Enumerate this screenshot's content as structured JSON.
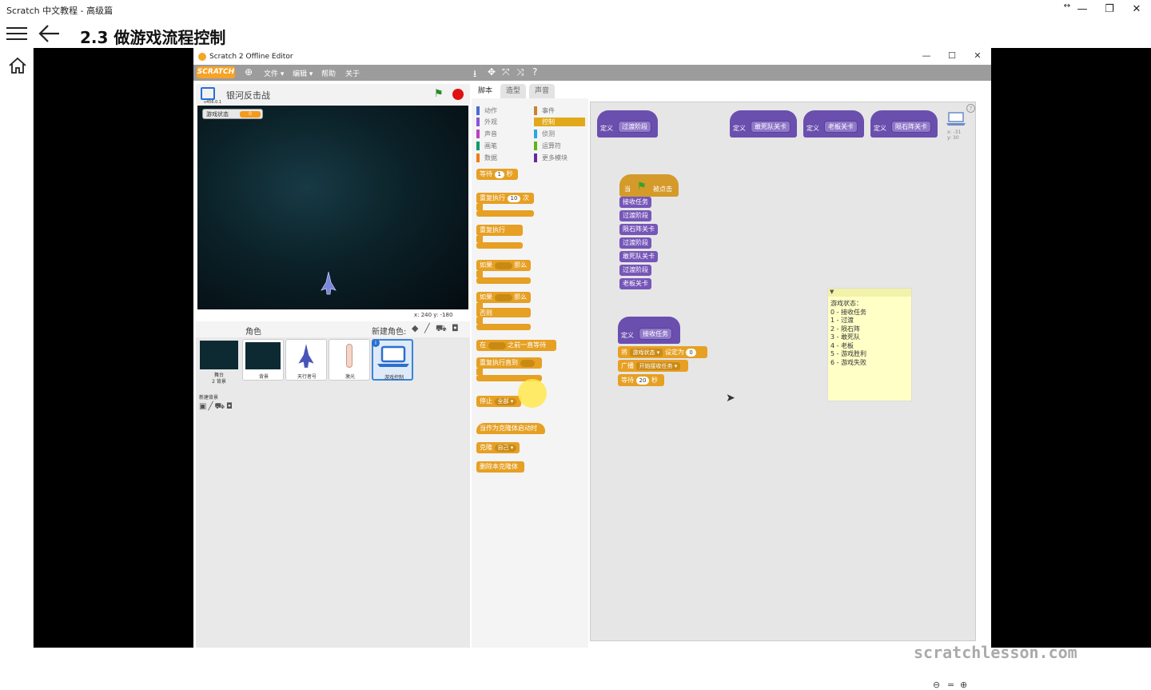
{
  "window": {
    "title": "Scratch 中文教程 - 高级篇",
    "resize_icon": "↔",
    "min": "—",
    "restore": "❐",
    "close": "✕"
  },
  "header": {
    "title": "2.3  做游戏流程控制"
  },
  "scratch": {
    "title": "Scratch 2 Offline Editor",
    "logo": "SCRATCH",
    "menu": [
      "文件 ▾",
      "编辑 ▾",
      "帮助",
      "关于"
    ],
    "tools": [
      "⭳",
      "✥",
      "⤧",
      "⤨",
      "?"
    ],
    "stage_title": "银河反击战",
    "version": "v456.0.1",
    "monitor": {
      "label": "游戏状态",
      "value": "0"
    },
    "coords": "x: 240   y: -180",
    "sprite_header": "角色",
    "new_sprite": "新建角色:",
    "stage_thumb": {
      "name": "舞台",
      "sub": "2 背景"
    },
    "new_backdrop": "新建背景",
    "sprites": [
      "背景",
      "天行者号",
      "激光",
      "游戏控制"
    ],
    "tabs": [
      "脚本",
      "造型",
      "声音"
    ],
    "categories_left": [
      "动作",
      "外观",
      "声音",
      "画笔",
      "数据"
    ],
    "categories_right": [
      "事件",
      "控制",
      "侦测",
      "运算符",
      "更多模块"
    ],
    "palette": {
      "wait": "等待",
      "wait_val": "1",
      "wait_unit": "秒",
      "repeat": "重复执行",
      "repeat_val": "10",
      "repeat_unit": "次",
      "forever": "重复执行",
      "if": "如果",
      "then": "那么",
      "if2": "如果",
      "then2": "那么",
      "else": "否则",
      "wait_until_pre": "在",
      "wait_until": "之前一直等待",
      "repeat_until": "重复执行直到",
      "stop": "停止",
      "stop_val": "全部 ▾",
      "clone_start": "当作为克隆体启动时",
      "clone": "克隆",
      "clone_val": "自己 ▾",
      "delete_clone": "删除本克隆体"
    },
    "defs": [
      {
        "k": "定义",
        "n": "过渡阶段"
      },
      {
        "k": "定义",
        "n": "敢死队关卡"
      },
      {
        "k": "定义",
        "n": "老板关卡"
      },
      {
        "k": "定义",
        "n": "陨石阵关卡"
      }
    ],
    "sprite_xy": "x: -31\ny: 30",
    "flag_script": {
      "hat_pre": "当",
      "hat_post": "被点击",
      "blocks": [
        "接收任务",
        "过渡阶段",
        "陨石阵关卡",
        "过渡阶段",
        "敢死队关卡",
        "过渡阶段",
        "老板关卡"
      ]
    },
    "recv_script": {
      "def": "定义",
      "name": "接收任务",
      "set": "将",
      "var": "游戏状态 ▾",
      "to": "设定为",
      "val": "0",
      "broadcast": "广播",
      "msg": "开始接收任务 ▾",
      "wait": "等待",
      "wait_val": "20",
      "wait_unit": "秒"
    },
    "note": [
      "游戏状态：",
      "0 - 接收任务",
      "1 - 过渡",
      "2 - 陨石阵",
      "3 - 敢死队",
      "4 - 老板",
      "5 - 游戏胜利",
      "6 - 游戏失败"
    ],
    "watermark": "scratchlesson.com",
    "zoom": [
      "🔍︎−",
      "=",
      "🔍︎+"
    ]
  },
  "colors": {
    "control": "#e6a024",
    "more_blocks": "#6a4fae",
    "menubar": "#9c9c9c"
  }
}
